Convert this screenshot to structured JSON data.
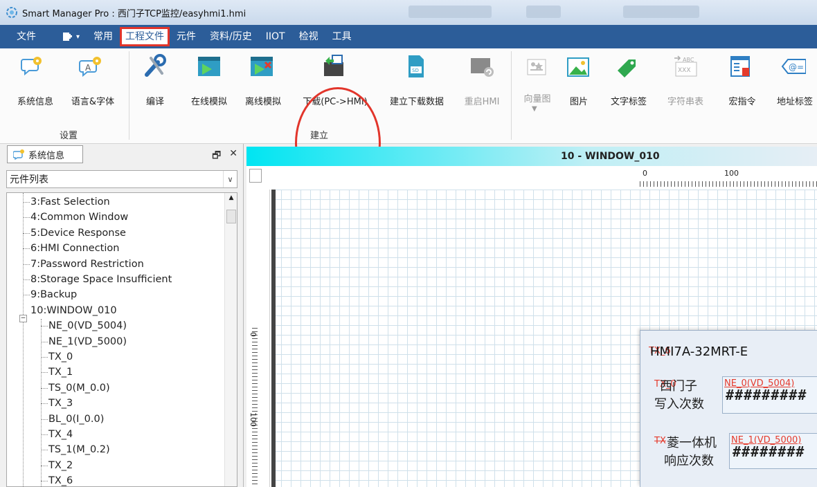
{
  "window": {
    "title": "Smart Manager Pro : 西门子TCP监控/easyhmi1.hmi"
  },
  "menubar": {
    "items": [
      "文件",
      "常用",
      "工程文件",
      "元件",
      "资料/历史",
      "IIOT",
      "检视",
      "工具"
    ],
    "active": "工程文件"
  },
  "ribbon": {
    "groups": [
      {
        "name": "设置",
        "items": [
          "系统信息",
          "语言&字体"
        ]
      },
      {
        "name": "建立",
        "items": [
          "编译",
          "在线模拟",
          "离线模拟",
          "下载(PC->HMI)",
          "建立下载数据",
          "重启HMI"
        ]
      },
      {
        "name": "",
        "items": [
          "向量图",
          "图片",
          "文字标签",
          "字符串表",
          "宏指令",
          "地址标签"
        ]
      }
    ],
    "labels": {
      "sysinfo": "系统信息",
      "langfont": "语言&字体",
      "compile": "编译",
      "online_sim": "在线模拟",
      "offline_sim": "离线模拟",
      "download": "下载(PC->HMI)",
      "build_data": "建立下载数据",
      "reboot": "重启HMI",
      "vector": "向量图",
      "picture": "图片",
      "text_tag": "文字标签",
      "string_table": "字符串表",
      "macro": "宏指令",
      "addr_tag": "地址标签",
      "group_setup": "设置",
      "group_build": "建立"
    },
    "disabled": [
      "重启HMI",
      "向量图",
      "字符串表"
    ],
    "highlight": "建立",
    "accent": "#e2352b"
  },
  "left_panel": {
    "tab": "系统信息",
    "combo": "元件列表",
    "tree": [
      {
        "label": "3:Fast Selection",
        "level": 1
      },
      {
        "label": "4:Common Window",
        "level": 1
      },
      {
        "label": "5:Device Response",
        "level": 1
      },
      {
        "label": "6:HMI Connection",
        "level": 1
      },
      {
        "label": "7:Password Restriction",
        "level": 1
      },
      {
        "label": "8:Storage Space Insufficient",
        "level": 1
      },
      {
        "label": "9:Backup",
        "level": 1
      },
      {
        "label": "10:WINDOW_010",
        "level": 1,
        "expanded": true
      },
      {
        "label": "NE_0(VD_5004)",
        "level": 2
      },
      {
        "label": "NE_1(VD_5000)",
        "level": 2
      },
      {
        "label": "TX_0",
        "level": 2
      },
      {
        "label": "TX_1",
        "level": 2
      },
      {
        "label": "TS_0(M_0.0)",
        "level": 2
      },
      {
        "label": "TX_3",
        "level": 2
      },
      {
        "label": "BL_0(I_0.0)",
        "level": 2
      },
      {
        "label": "TX_4",
        "level": 2
      },
      {
        "label": "TS_1(M_0.2)",
        "level": 2
      },
      {
        "label": "TX_2",
        "level": 2
      },
      {
        "label": "TX_6",
        "level": 2
      }
    ]
  },
  "editor": {
    "window_title": "10 - WINDOW_010",
    "ruler_top": [
      "0",
      "100"
    ],
    "ruler_left": [
      "0",
      "100"
    ],
    "hmi": {
      "model": "HMI7A-32MRT-E",
      "model_overlay": "TX_6",
      "row1_label_1": "西门子",
      "row1_label_2": "写入次数",
      "row1_overlay": "TX_0",
      "row1_tag": "NE_0(VD_5004)",
      "row1_value": "#########",
      "row2_label_1": "菱一体机",
      "row2_label_2": "响应次数",
      "row2_overlay": "TX",
      "row2_tag": "NE_1(VD_5000)",
      "row2_value": "########"
    }
  },
  "colors": {
    "menubar": "#2c5d99",
    "highlight": "#e2352b",
    "window_bar": "#00e5f2"
  }
}
